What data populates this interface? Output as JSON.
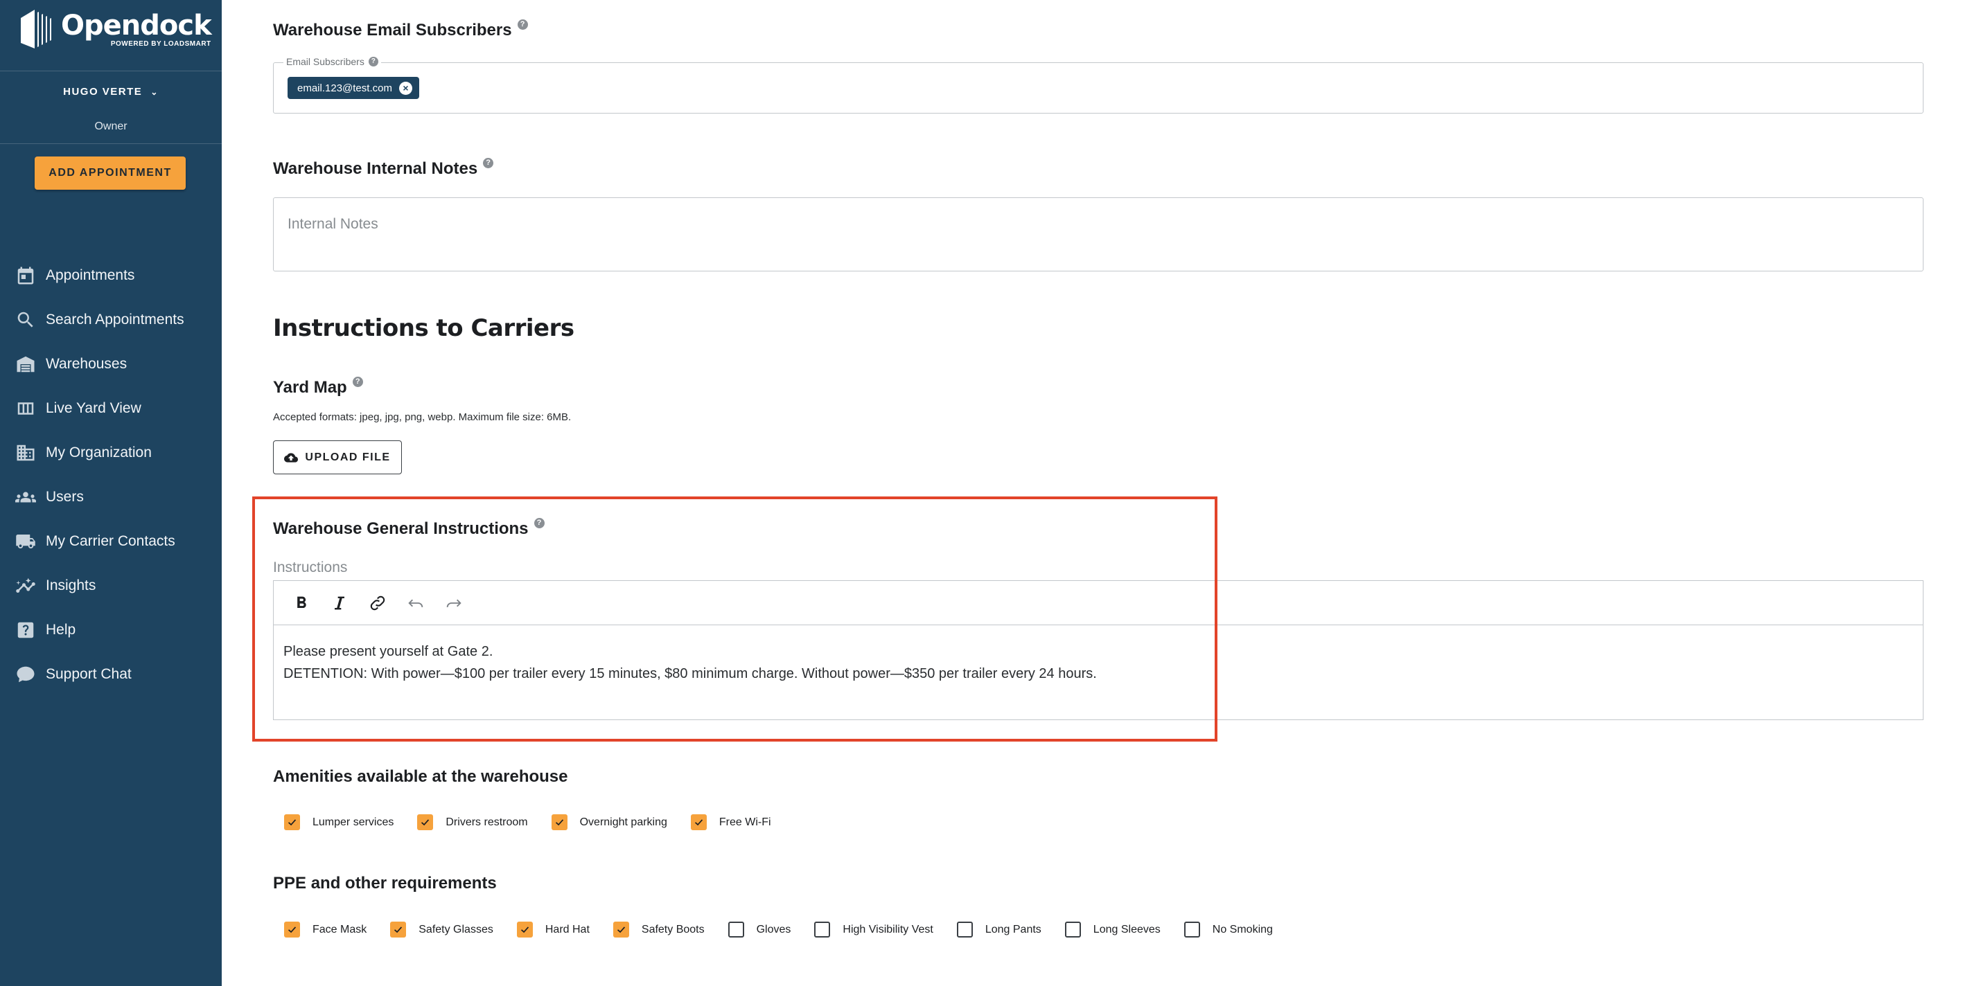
{
  "app": {
    "name": "Opendock",
    "tagline": "POWERED BY LOADSMART"
  },
  "user": {
    "name": "HUGO VERTE",
    "role": "Owner"
  },
  "sidebar": {
    "add_button": "ADD APPOINTMENT",
    "items": [
      {
        "label": "Appointments",
        "icon": "calendar-icon"
      },
      {
        "label": "Search Appointments",
        "icon": "search-icon"
      },
      {
        "label": "Warehouses",
        "icon": "warehouse-icon"
      },
      {
        "label": "Live Yard View",
        "icon": "columns-icon"
      },
      {
        "label": "My Organization",
        "icon": "building-icon"
      },
      {
        "label": "Users",
        "icon": "users-icon"
      },
      {
        "label": "My Carrier Contacts",
        "icon": "truck-icon"
      },
      {
        "label": "Insights",
        "icon": "chart-line-icon"
      },
      {
        "label": "Help",
        "icon": "help-icon"
      },
      {
        "label": "Support Chat",
        "icon": "chat-bubble-icon"
      }
    ]
  },
  "email_section": {
    "title": "Warehouse Email Subscribers",
    "field_label": "Email Subscribers",
    "chips": [
      "email.123@test.com"
    ]
  },
  "notes_section": {
    "title": "Warehouse Internal Notes",
    "placeholder": "Internal Notes"
  },
  "carriers_heading": "Instructions to Carriers",
  "yard_map": {
    "title": "Yard Map",
    "help_text": "Accepted formats: jpeg, jpg, png, webp. Maximum file size: 6MB.",
    "upload_label": "UPLOAD FILE"
  },
  "general_instructions": {
    "title": "Warehouse General Instructions",
    "label": "Instructions",
    "lines": [
      "Please present yourself at Gate 2.",
      "DETENTION: With power—$100 per trailer every 15 minutes, $80 minimum charge. Without power—$350 per trailer every 24 hours."
    ]
  },
  "amenities": {
    "title": "Amenities available at the warehouse",
    "items": [
      {
        "label": "Lumper services",
        "checked": true
      },
      {
        "label": "Drivers restroom",
        "checked": true
      },
      {
        "label": "Overnight parking",
        "checked": true
      },
      {
        "label": "Free Wi-Fi",
        "checked": true
      }
    ]
  },
  "ppe": {
    "title": "PPE and other requirements",
    "items": [
      {
        "label": "Face Mask",
        "checked": true
      },
      {
        "label": "Safety Glasses",
        "checked": true
      },
      {
        "label": "Hard Hat",
        "checked": true
      },
      {
        "label": "Safety Boots",
        "checked": true
      },
      {
        "label": "Gloves",
        "checked": false
      },
      {
        "label": "High Visibility Vest",
        "checked": false
      },
      {
        "label": "Long Pants",
        "checked": false
      },
      {
        "label": "Long Sleeves",
        "checked": false
      },
      {
        "label": "No Smoking",
        "checked": false
      }
    ]
  },
  "colors": {
    "sidebar_bg": "#1e4460",
    "accent_orange": "#f6a23c",
    "highlight_red": "#e2442a"
  }
}
